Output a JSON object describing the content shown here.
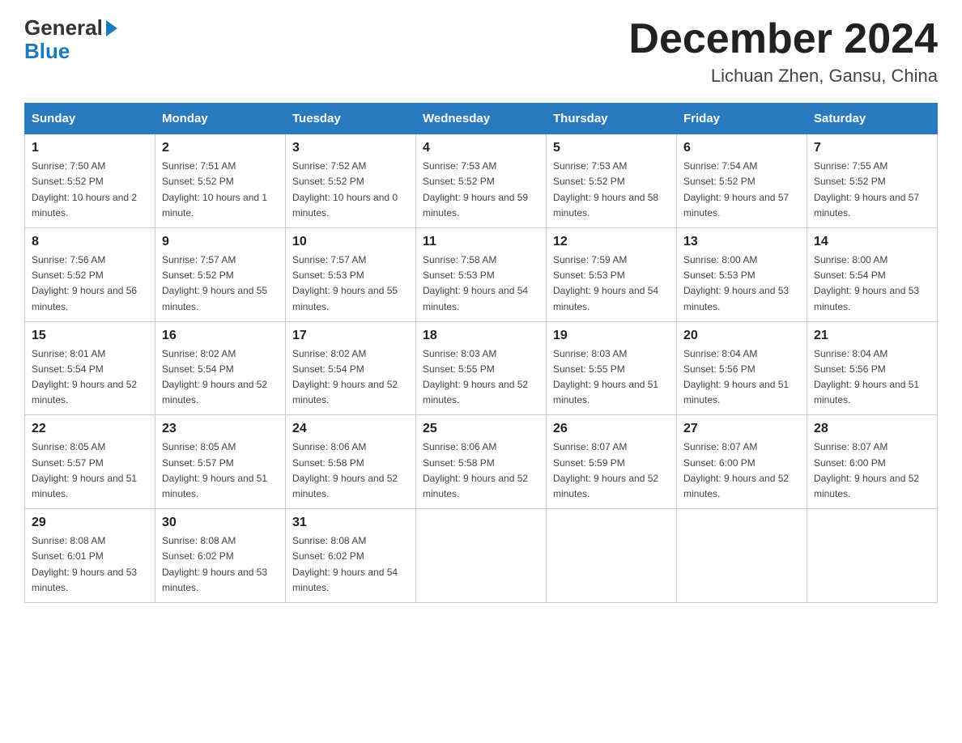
{
  "header": {
    "logo": {
      "text_general": "General",
      "text_blue": "Blue"
    },
    "month_title": "December 2024",
    "location": "Lichuan Zhen, Gansu, China"
  },
  "weekdays": [
    "Sunday",
    "Monday",
    "Tuesday",
    "Wednesday",
    "Thursday",
    "Friday",
    "Saturday"
  ],
  "weeks": [
    [
      {
        "day": "1",
        "sunrise": "7:50 AM",
        "sunset": "5:52 PM",
        "daylight": "10 hours and 2 minutes."
      },
      {
        "day": "2",
        "sunrise": "7:51 AM",
        "sunset": "5:52 PM",
        "daylight": "10 hours and 1 minute."
      },
      {
        "day": "3",
        "sunrise": "7:52 AM",
        "sunset": "5:52 PM",
        "daylight": "10 hours and 0 minutes."
      },
      {
        "day": "4",
        "sunrise": "7:53 AM",
        "sunset": "5:52 PM",
        "daylight": "9 hours and 59 minutes."
      },
      {
        "day": "5",
        "sunrise": "7:53 AM",
        "sunset": "5:52 PM",
        "daylight": "9 hours and 58 minutes."
      },
      {
        "day": "6",
        "sunrise": "7:54 AM",
        "sunset": "5:52 PM",
        "daylight": "9 hours and 57 minutes."
      },
      {
        "day": "7",
        "sunrise": "7:55 AM",
        "sunset": "5:52 PM",
        "daylight": "9 hours and 57 minutes."
      }
    ],
    [
      {
        "day": "8",
        "sunrise": "7:56 AM",
        "sunset": "5:52 PM",
        "daylight": "9 hours and 56 minutes."
      },
      {
        "day": "9",
        "sunrise": "7:57 AM",
        "sunset": "5:52 PM",
        "daylight": "9 hours and 55 minutes."
      },
      {
        "day": "10",
        "sunrise": "7:57 AM",
        "sunset": "5:53 PM",
        "daylight": "9 hours and 55 minutes."
      },
      {
        "day": "11",
        "sunrise": "7:58 AM",
        "sunset": "5:53 PM",
        "daylight": "9 hours and 54 minutes."
      },
      {
        "day": "12",
        "sunrise": "7:59 AM",
        "sunset": "5:53 PM",
        "daylight": "9 hours and 54 minutes."
      },
      {
        "day": "13",
        "sunrise": "8:00 AM",
        "sunset": "5:53 PM",
        "daylight": "9 hours and 53 minutes."
      },
      {
        "day": "14",
        "sunrise": "8:00 AM",
        "sunset": "5:54 PM",
        "daylight": "9 hours and 53 minutes."
      }
    ],
    [
      {
        "day": "15",
        "sunrise": "8:01 AM",
        "sunset": "5:54 PM",
        "daylight": "9 hours and 52 minutes."
      },
      {
        "day": "16",
        "sunrise": "8:02 AM",
        "sunset": "5:54 PM",
        "daylight": "9 hours and 52 minutes."
      },
      {
        "day": "17",
        "sunrise": "8:02 AM",
        "sunset": "5:54 PM",
        "daylight": "9 hours and 52 minutes."
      },
      {
        "day": "18",
        "sunrise": "8:03 AM",
        "sunset": "5:55 PM",
        "daylight": "9 hours and 52 minutes."
      },
      {
        "day": "19",
        "sunrise": "8:03 AM",
        "sunset": "5:55 PM",
        "daylight": "9 hours and 51 minutes."
      },
      {
        "day": "20",
        "sunrise": "8:04 AM",
        "sunset": "5:56 PM",
        "daylight": "9 hours and 51 minutes."
      },
      {
        "day": "21",
        "sunrise": "8:04 AM",
        "sunset": "5:56 PM",
        "daylight": "9 hours and 51 minutes."
      }
    ],
    [
      {
        "day": "22",
        "sunrise": "8:05 AM",
        "sunset": "5:57 PM",
        "daylight": "9 hours and 51 minutes."
      },
      {
        "day": "23",
        "sunrise": "8:05 AM",
        "sunset": "5:57 PM",
        "daylight": "9 hours and 51 minutes."
      },
      {
        "day": "24",
        "sunrise": "8:06 AM",
        "sunset": "5:58 PM",
        "daylight": "9 hours and 52 minutes."
      },
      {
        "day": "25",
        "sunrise": "8:06 AM",
        "sunset": "5:58 PM",
        "daylight": "9 hours and 52 minutes."
      },
      {
        "day": "26",
        "sunrise": "8:07 AM",
        "sunset": "5:59 PM",
        "daylight": "9 hours and 52 minutes."
      },
      {
        "day": "27",
        "sunrise": "8:07 AM",
        "sunset": "6:00 PM",
        "daylight": "9 hours and 52 minutes."
      },
      {
        "day": "28",
        "sunrise": "8:07 AM",
        "sunset": "6:00 PM",
        "daylight": "9 hours and 52 minutes."
      }
    ],
    [
      {
        "day": "29",
        "sunrise": "8:08 AM",
        "sunset": "6:01 PM",
        "daylight": "9 hours and 53 minutes."
      },
      {
        "day": "30",
        "sunrise": "8:08 AM",
        "sunset": "6:02 PM",
        "daylight": "9 hours and 53 minutes."
      },
      {
        "day": "31",
        "sunrise": "8:08 AM",
        "sunset": "6:02 PM",
        "daylight": "9 hours and 54 minutes."
      },
      null,
      null,
      null,
      null
    ]
  ]
}
